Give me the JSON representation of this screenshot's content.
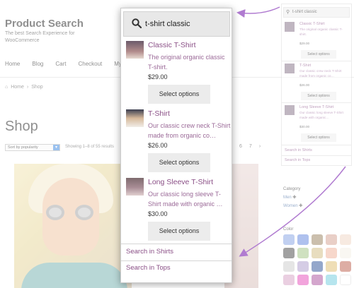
{
  "site": {
    "title": "Product Search",
    "description": "The best Search Experience for WooCommerce"
  },
  "nav": [
    "Home",
    "Blog",
    "Cart",
    "Checkout",
    "My acco"
  ],
  "breadcrumb": {
    "home": "Home",
    "separator": "›",
    "current": "Shop"
  },
  "page_title": "Shop",
  "sort": {
    "selected": "Sort by popularity"
  },
  "results_text": "Showing 1–8 of 55 results",
  "pagination": [
    "6",
    "7",
    "›"
  ],
  "filters": {
    "category_title": "Category",
    "categories": [
      "Men",
      "Women"
    ],
    "color_title": "Color",
    "swatches": [
      "#8fa9e6",
      "#6d8fe0",
      "#a08b6a",
      "#d8a89a",
      "#f0d9c8",
      "#555555",
      "#a8c98d",
      "#d6c28a",
      "#f0b7a0",
      "#f5f0e8",
      "#cfcfcf",
      "#b2a2d0",
      "#3c5fa0",
      "#e2c37a",
      "#c26a5a",
      "#d9a8c9",
      "#e85ac0",
      "#b15ea5",
      "#7ad0e0",
      "#ffffff"
    ]
  },
  "mini_widget": {
    "query": "t-shirt classic",
    "items": [
      {
        "title": "Classic T-Shirt",
        "desc": "The original organic classic T-shirt.",
        "price": "$29.00",
        "button": "Select options"
      },
      {
        "title": "T-Shirt",
        "desc": "Our classic crew neck T-Shirt made from organic co…",
        "price": "$26.00",
        "button": "Select options"
      },
      {
        "title": "Long Sleeve T-Shirt",
        "desc": "Our classic long sleeve T-Shirt made with organic…",
        "price": "$30.00",
        "button": "Select options"
      }
    ],
    "links": [
      "Search in Shirts",
      "Search in Tops"
    ]
  },
  "popup": {
    "query": "t-shirt classic",
    "items": [
      {
        "title": "Classic T-Shirt",
        "desc": "The original organic classic T-shirt.",
        "price": "$29.00",
        "button": "Select options"
      },
      {
        "title": "T-Shirt",
        "desc": "Our classic crew neck T-Shirt made from organic co…",
        "price": "$26.00",
        "button": "Select options"
      },
      {
        "title": "Long Sleeve T-Shirt",
        "desc": "Our classic long sleeve T-Shirt made with organic …",
        "price": "$30.00",
        "button": "Select options"
      }
    ],
    "links": [
      "Search in Shirts",
      "Search in Tops"
    ]
  },
  "colors": {
    "accent": "#8a4f86",
    "arrow": "#b07bd0"
  }
}
